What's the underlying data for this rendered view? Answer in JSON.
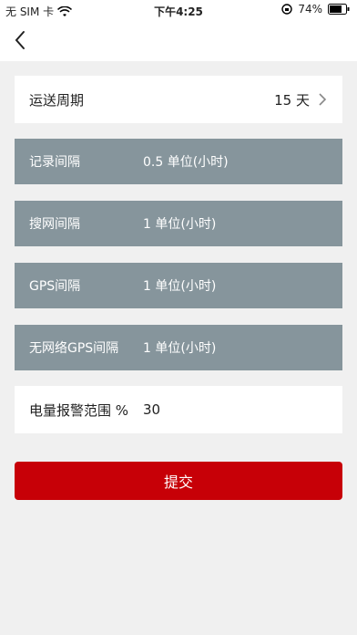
{
  "status_bar": {
    "carrier": "无 SIM 卡",
    "time": "下午4:25",
    "battery": "74%",
    "icons": [
      "wifi-icon",
      "orientation-lock-icon",
      "battery-icon"
    ]
  },
  "nav": {
    "back_icon": "chevron-left-icon"
  },
  "form": {
    "period": {
      "label": "运送周期",
      "value": "15 天"
    },
    "settings": [
      {
        "label": "记录间隔",
        "value": "0.5  单位(小时)"
      },
      {
        "label": "搜网间隔",
        "value": "1  单位(小时)"
      },
      {
        "label": "GPS间隔",
        "value": "1  单位(小时)"
      },
      {
        "label": "无网络GPS间隔",
        "value": "1  单位(小时)"
      }
    ],
    "battery_alert": {
      "label": "电量报警范围 %",
      "value": "30"
    }
  },
  "submit_label": "提交",
  "colors": {
    "accent": "#c70007",
    "row_gray": "#86959c",
    "background": "#f0f0f0"
  }
}
